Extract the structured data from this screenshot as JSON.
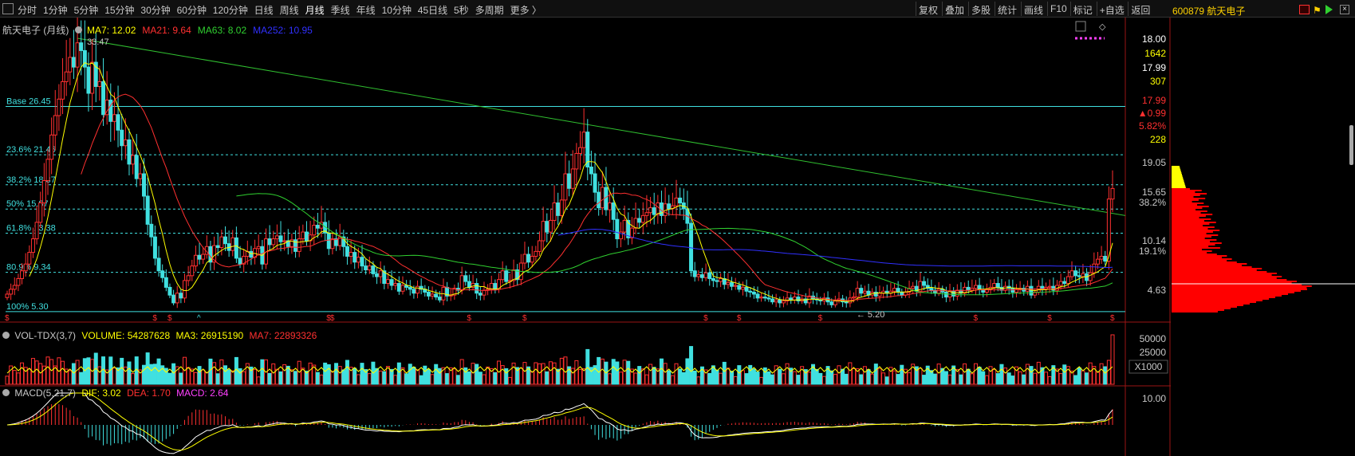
{
  "toolbar": {
    "left_items": [
      "分时",
      "1分钟",
      "5分钟",
      "15分钟",
      "30分钟",
      "60分钟",
      "120分钟",
      "日线",
      "周线",
      "月线",
      "季线",
      "年线",
      "10分钟",
      "45日线",
      "5秒",
      "多周期",
      "更多 〉"
    ],
    "active": "月线",
    "right_items": [
      "复权",
      "叠加",
      "多股",
      "统计",
      "画线",
      "F10",
      "标记",
      "+自选",
      "返回"
    ]
  },
  "stock": {
    "code": "600879",
    "name": "航天电子",
    "code_label": "600879 航天电子"
  },
  "main_chart": {
    "title": "航天电子 (月线)",
    "ma": [
      {
        "label": "MA7: 12.02",
        "color": "#ffff00"
      },
      {
        "label": "MA21: 9.64",
        "color": "#ff3030"
      },
      {
        "label": "MA63: 8.02",
        "color": "#30d030"
      },
      {
        "label": "MA252: 10.95",
        "color": "#3030ff"
      }
    ],
    "high_label": "33.47",
    "low_label": "5.20",
    "fib_levels": [
      {
        "label": "Base 26.45",
        "price": 26.45
      },
      {
        "label": "23.6% 21.46",
        "price": 21.46
      },
      {
        "label": "38.2% 18.37",
        "price": 18.37
      },
      {
        "label": "50% 15.87",
        "price": 15.87
      },
      {
        "label": "61.8% 13.38",
        "price": 13.38
      },
      {
        "label": "80.9% 9.34",
        "price": 9.34
      },
      {
        "label": "100% 5.30",
        "price": 5.3
      }
    ],
    "price_axis": [
      {
        "text": "18.00",
        "color": "#ffffff"
      },
      {
        "text": "1642",
        "color": "#ffff00"
      },
      {
        "text": "17.99",
        "color": "#ffffff"
      },
      {
        "text": "307",
        "color": "#ffff00"
      },
      {
        "text": "17.99",
        "color": "#ff3030"
      },
      {
        "text": "▲0.99",
        "color": "#ff3030"
      },
      {
        "text": "5.82%",
        "color": "#ff3030"
      },
      {
        "text": "228",
        "color": "#ffff00"
      },
      {
        "text": "19.05",
        "color": "#c8c8c8"
      },
      {
        "text": "15.65",
        "color": "#c8c8c8"
      },
      {
        "text": "38.2%",
        "color": "#c8c8c8"
      },
      {
        "text": "10.14",
        "color": "#c8c8c8"
      },
      {
        "text": "19.1%",
        "color": "#c8c8c8"
      },
      {
        "text": "4.63",
        "color": "#c8c8c8"
      }
    ]
  },
  "volume": {
    "title": "VOL-TDX(3,7)",
    "items": [
      {
        "label": "VOLUME: 54287628",
        "color": "#ffff00"
      },
      {
        "label": "MA3: 26915190",
        "color": "#ffff00"
      },
      {
        "label": "MA7: 22893326",
        "color": "#ff3030"
      }
    ],
    "axis": [
      "50000",
      "25000"
    ],
    "unit": "X1000"
  },
  "macd": {
    "title": "MACD(5,21,7)",
    "items": [
      {
        "label": "DIF: 3.02",
        "color": "#ffff00"
      },
      {
        "label": "DEA: 1.70",
        "color": "#ff3030"
      },
      {
        "label": "MACD: 2.64",
        "color": "#ff40ff"
      }
    ],
    "axis": [
      "10.00"
    ]
  },
  "colors": {
    "up": "#ff3030",
    "down": "#40e0e0",
    "fib": "#40e0e0",
    "trendline": "#30c030"
  },
  "chart_data": {
    "type": "candlestick",
    "period": "monthly",
    "y_range": [
      4.63,
      33.47
    ],
    "closes": [
      7.1,
      7.6,
      8.0,
      8.7,
      9.5,
      10.2,
      11.4,
      12.8,
      14.5,
      16.5,
      18.8,
      21.0,
      23.5,
      25.5,
      27.2,
      29.0,
      30.0,
      31.5,
      30.5,
      33.0,
      32.2,
      30.5,
      27.8,
      31.0,
      28.5,
      29.0,
      25.6,
      27.1,
      24.9,
      25.6,
      24.0,
      22.4,
      23.0,
      20.5,
      21.4,
      19.0,
      19.5,
      17.2,
      14.3,
      13.0,
      10.8,
      9.5,
      8.8,
      7.8,
      7.0,
      6.2,
      7.2,
      6.7,
      8.5,
      9.0,
      10.0,
      11.1,
      10.7,
      11.2,
      12.0,
      10.4,
      12.1,
      11.9,
      13.0,
      12.3,
      11.6,
      12.9,
      10.8,
      10.2,
      11.0,
      11.5,
      10.9,
      11.8,
      12.0,
      10.2,
      12.8,
      12.2,
      12.8,
      13.1,
      12.5,
      12.6,
      12.0,
      12.7,
      11.5,
      12.8,
      13.5,
      12.6,
      13.2,
      14.2,
      13.9,
      14.5,
      13.4,
      11.8,
      12.8,
      12.1,
      13.0,
      12.0,
      11.0,
      11.4,
      10.4,
      10.9,
      10.0,
      9.6,
      10.0,
      9.2,
      8.9,
      9.5,
      8.2,
      8.6,
      8.0,
      8.2,
      7.4,
      8.0,
      7.8,
      7.6,
      7.2,
      7.9,
      7.6,
      7.3,
      6.9,
      7.1,
      6.8,
      6.5,
      7.8,
      6.9,
      7.0,
      7.7,
      7.5,
      9.0,
      8.4,
      7.8,
      8.2,
      7.2,
      7.0,
      7.5,
      7.6,
      8.2,
      7.6,
      8.6,
      9.5,
      8.4,
      8.5,
      9.6,
      8.6,
      10.3,
      11.2,
      10.4,
      11.0,
      11.5,
      12.6,
      14.6,
      13.5,
      14.7,
      16.5,
      15.2,
      16.8,
      19.5,
      18.0,
      20.0,
      21.6,
      22.2,
      23.8,
      20.2,
      19.5,
      17.6,
      16.0,
      18.1,
      15.8,
      16.5,
      14.8,
      12.8,
      13.5,
      14.7,
      12.9,
      13.9,
      14.9,
      14.5,
      15.2,
      15.5,
      16.0,
      15.3,
      16.5,
      15.2,
      16.4,
      15.9,
      16.2,
      17.0,
      16.5,
      15.9,
      14.4,
      9.5,
      8.9,
      9.1,
      8.8,
      9.3,
      8.7,
      8.5,
      8.4,
      8.7,
      8.1,
      8.3,
      7.9,
      8.0,
      7.6,
      7.8,
      7.4,
      7.3,
      7.1,
      6.7,
      6.8,
      6.7,
      6.6,
      6.3,
      6.5,
      6.2,
      6.4,
      6.7,
      6.5,
      6.8,
      6.4,
      6.6,
      6.2,
      6.9,
      6.6,
      6.5,
      6.4,
      6.7,
      6.3,
      6.0,
      6.4,
      6.6,
      6.3,
      6.2,
      6.7,
      6.8,
      7.7,
      7.2,
      7.4,
      7.0,
      7.3,
      6.9,
      7.2,
      7.4,
      7.2,
      7.4,
      7.7,
      7.3,
      7.0,
      7.3,
      7.7,
      7.9,
      7.4,
      8.4,
      8.0,
      7.7,
      7.5,
      7.2,
      7.6,
      7.3,
      6.8,
      7.4,
      6.9,
      7.5,
      7.2,
      7.8,
      7.5,
      7.7,
      8.0,
      7.6,
      7.3,
      7.6,
      7.8,
      8.2,
      7.8,
      7.5,
      7.9,
      7.7,
      7.3,
      7.6,
      7.7,
      7.4,
      7.9,
      7.0,
      7.3,
      7.9,
      7.6,
      7.8,
      7.9,
      7.5,
      8.0,
      8.4,
      8.2,
      8.9,
      9.5,
      9.0,
      8.9,
      9.2,
      8.5,
      9.3,
      10.2,
      10.7,
      11.0,
      10.5,
      16.9,
      17.99
    ],
    "ma7_last": 12.02,
    "ma21_last": 9.64,
    "ma63_last": 8.02,
    "ma252_last": 10.95
  }
}
